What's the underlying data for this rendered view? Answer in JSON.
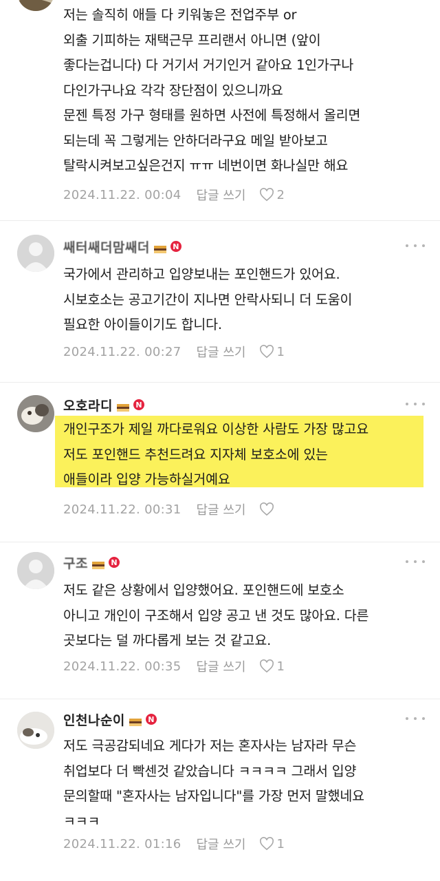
{
  "comments": [
    {
      "body": "저는 솔직히 애들 다 키워놓은 전업주부 or\n외출 기피하는 재택근무 프리랜서 아니면 (앞이\n좋다는겁니다) 다 거기서 거기인거 같아요 1인가구나\n다인가구나요 각각 장단점이 있으니까요\n문젠 특정 가구 형태를 원하면 사전에 특정해서 올리면\n되는데 꼭 그렇게는 안하더라구요 메일 받아보고\n탈락시켜보고싶은건지 ㅠㅠ 네번이면 화나실만 해요",
      "date": "2024.11.22. 00:04",
      "reply": "답글 쓰기",
      "likes": "2"
    },
    {
      "nickname": "쌔터쌔더맘쌔더",
      "body": "국가에서 관리하고 입양보내는 포인핸드가 있어요.\n시보호소는 공고기간이 지나면 안락사되니 더 도움이\n필요한 아이들이기도 합니다.",
      "date": "2024.11.22. 00:27",
      "reply": "답글 쓰기",
      "likes": "1"
    },
    {
      "nickname": "오호라디",
      "body": "개인구조가 제일 까다로워요 이상한 사람도 가장 많고요\n저도 포인핸드 추천드려요 지자체 보호소에 있는\n애들이라 입양 가능하실거예요",
      "date": "2024.11.22. 00:31",
      "reply": "답글 쓰기",
      "likes": ""
    },
    {
      "nickname": "구조",
      "body": "저도 같은 상황에서 입양했어요. 포인핸드에 보호소\n아니고 개인이 구조해서 입양 공고 낸 것도 많아요. 다른\n곳보다는 덜 까다롭게 보는 것 같고요.",
      "date": "2024.11.22. 00:35",
      "reply": "답글 쓰기",
      "likes": "1"
    },
    {
      "nickname": "인천나순이",
      "body": "저도 극공감되네요 게다가 저는 혼자사는 남자라 무슨\n취업보다 더 빡센것 같았습니다 ㅋㅋㅋㅋ 그래서 입양\n문의할때 \"혼자사는 남자입니다\"를 가장 먼저 말했네요\nㅋㅋㅋ",
      "date": "2024.11.22. 01:16",
      "reply": "답글 쓰기",
      "likes": "1"
    }
  ],
  "badge_n_label": "N",
  "colors": {
    "highlight": "#fbf15b",
    "badge_red": "#e5233f",
    "meta_gray": "#a3a3a3"
  },
  "icons": [
    "cake-badge-icon",
    "new-badge-icon",
    "more-options-icon",
    "heart-icon"
  ]
}
